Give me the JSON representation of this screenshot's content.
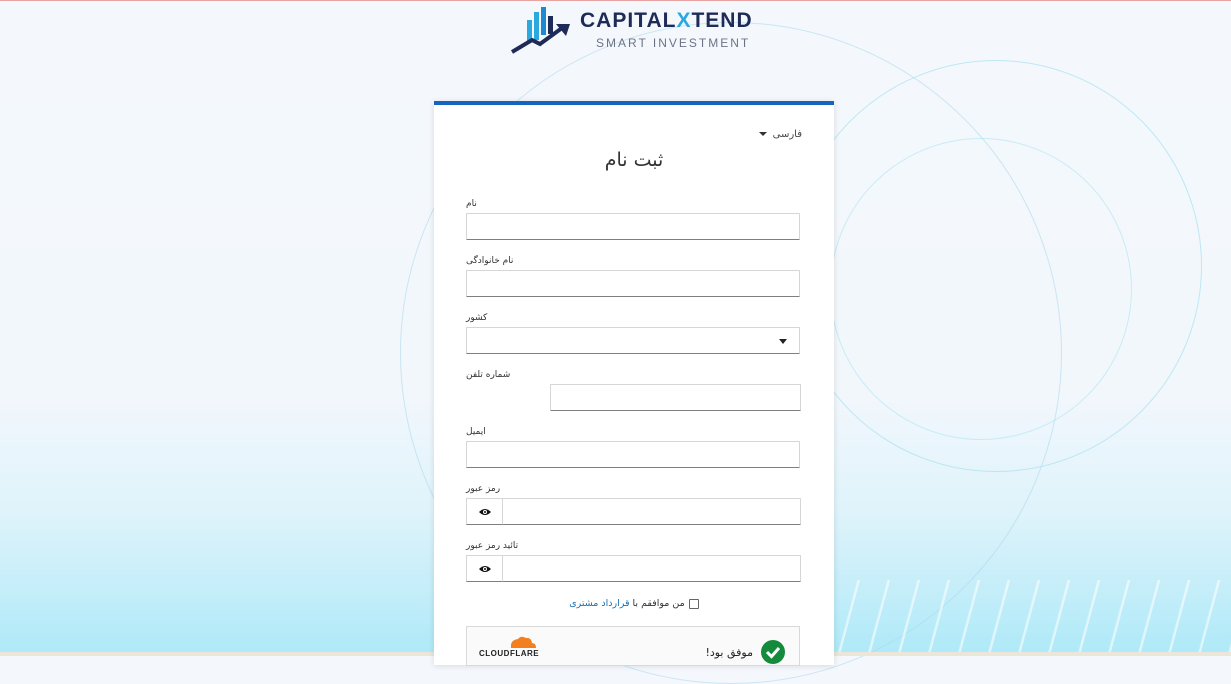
{
  "brand": {
    "name_part1": "CAPITAL",
    "name_x": "X",
    "name_part2": "TEND",
    "tagline": "SMART INVESTMENT"
  },
  "language": {
    "selected": "فارسی",
    "icon": "caret-down-icon"
  },
  "form": {
    "title": "ثبت نام",
    "fields": {
      "first_name": {
        "label": "نام",
        "value": ""
      },
      "last_name": {
        "label": "نام خانوادگی",
        "value": ""
      },
      "country": {
        "label": "کشور",
        "value": ""
      },
      "phone": {
        "label": "شماره تلفن",
        "value": ""
      },
      "email": {
        "label": "ایمیل",
        "value": ""
      },
      "password": {
        "label": "رمز عبور",
        "value": "",
        "toggle_icon": "eye-icon"
      },
      "confirm_password": {
        "label": "تائید رمز عبور",
        "value": "",
        "toggle_icon": "eye-icon"
      }
    },
    "agreement": {
      "prefix": "من موافقم با",
      "link_text": "قرارداد مشتری",
      "checked": false
    }
  },
  "captcha": {
    "provider": "CLOUDFLARE",
    "status_text": "موفق بود!",
    "status_icon": "check-circle-icon",
    "status_color": "#148a3c"
  },
  "colors": {
    "accent": "#1565c0",
    "link": "#1a6fb0",
    "brand_dark": "#1e2b57",
    "brand_light": "#2ba8e0"
  }
}
